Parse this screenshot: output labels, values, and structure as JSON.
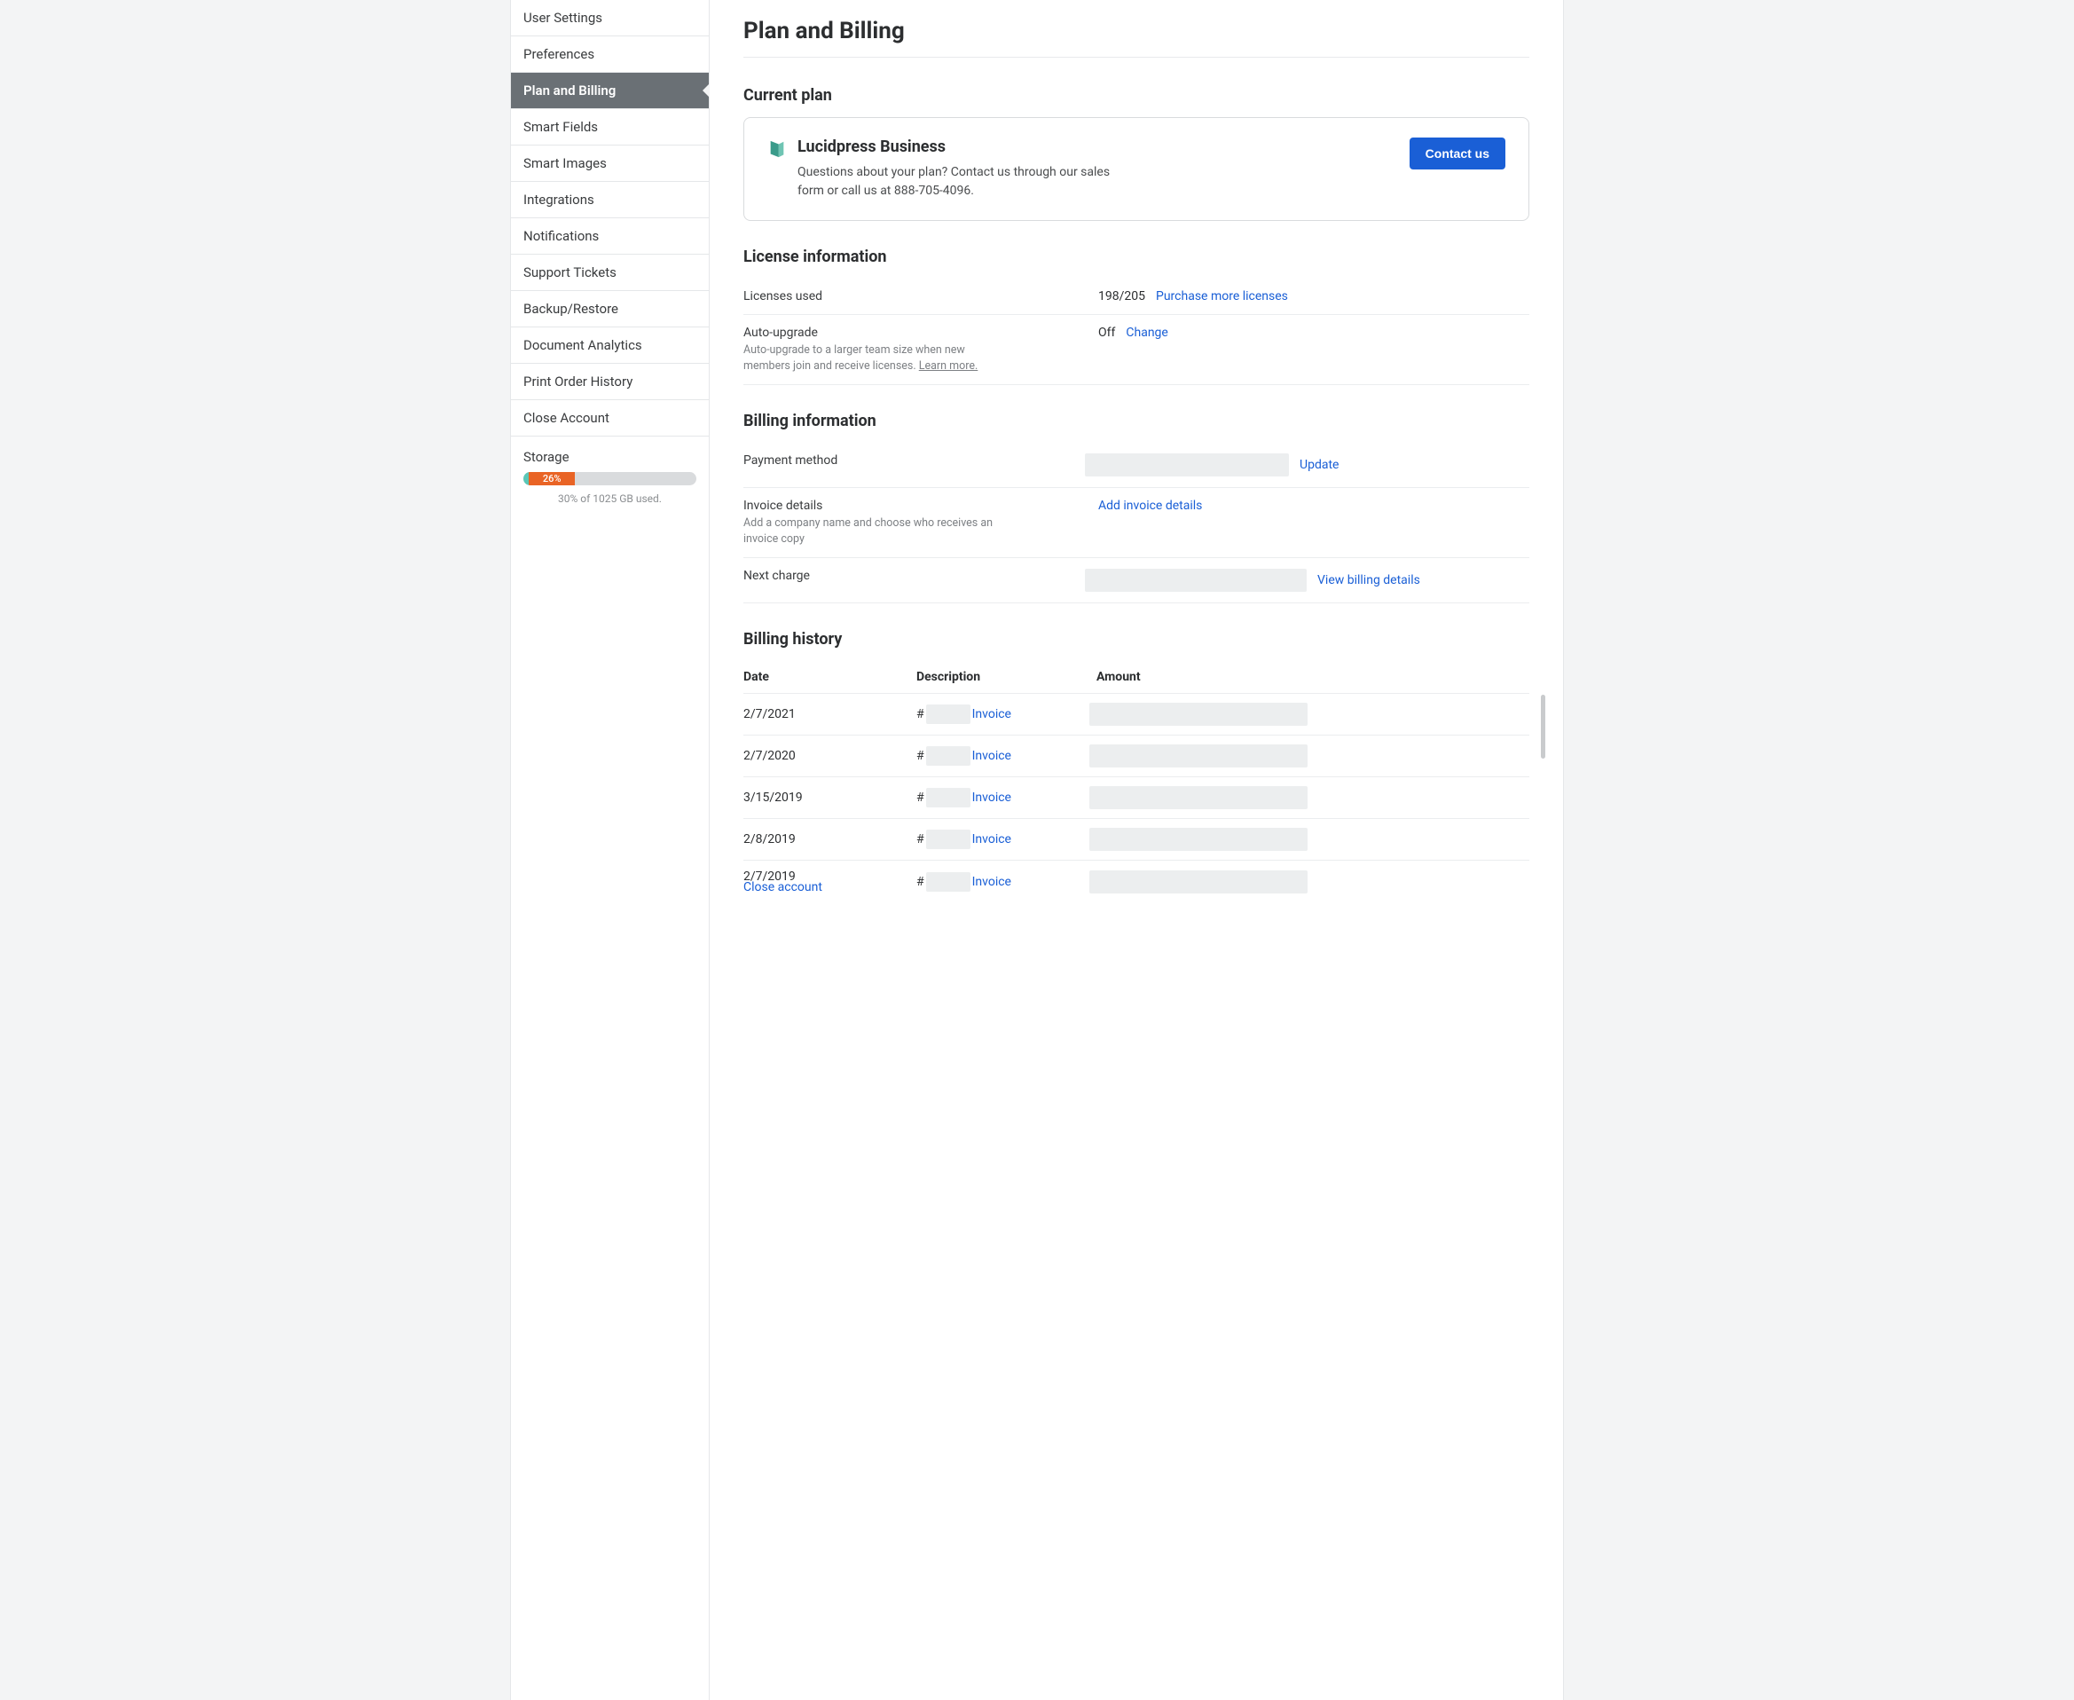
{
  "sidebar": {
    "items": [
      {
        "label": "User Settings",
        "active": false
      },
      {
        "label": "Preferences",
        "active": false
      },
      {
        "label": "Plan and Billing",
        "active": true
      },
      {
        "label": "Smart Fields",
        "active": false
      },
      {
        "label": "Smart Images",
        "active": false
      },
      {
        "label": "Integrations",
        "active": false
      },
      {
        "label": "Notifications",
        "active": false
      },
      {
        "label": "Support Tickets",
        "active": false
      },
      {
        "label": "Backup/Restore",
        "active": false
      },
      {
        "label": "Document Analytics",
        "active": false
      },
      {
        "label": "Print Order History",
        "active": false
      },
      {
        "label": "Close Account",
        "active": false
      }
    ],
    "storage": {
      "title": "Storage",
      "percent_label": "26%",
      "caption": "30% of 1025 GB used."
    }
  },
  "page": {
    "title": "Plan and Billing"
  },
  "current_plan": {
    "section_title": "Current plan",
    "plan_name": "Lucidpress Business",
    "description": "Questions about your plan? Contact us through our sales form or call us at 888-705-4096.",
    "contact_button": "Contact us"
  },
  "license_info": {
    "section_title": "License information",
    "licenses_used_label": "Licenses used",
    "licenses_used_value": "198/205",
    "purchase_link": "Purchase more licenses",
    "auto_upgrade_label": "Auto-upgrade",
    "auto_upgrade_sub": "Auto-upgrade to a larger team size when new members join and receive licenses. ",
    "learn_more": "Learn more.",
    "auto_upgrade_value": "Off",
    "change_link": "Change"
  },
  "billing_info": {
    "section_title": "Billing information",
    "payment_method_label": "Payment method",
    "update_link": "Update",
    "invoice_details_label": "Invoice details",
    "invoice_details_sub": "Add a company name and choose who receives an invoice copy",
    "add_invoice_link": "Add invoice details",
    "next_charge_label": "Next charge",
    "view_billing_link": "View billing details"
  },
  "billing_history": {
    "section_title": "Billing history",
    "columns": {
      "date": "Date",
      "description": "Description",
      "amount": "Amount"
    },
    "invoice_link_label": "Invoice",
    "rows": [
      {
        "date": "2/7/2021",
        "hash": "#"
      },
      {
        "date": "2/7/2020",
        "hash": "#"
      },
      {
        "date": "3/15/2019",
        "hash": "#"
      },
      {
        "date": "2/8/2019",
        "hash": "#"
      },
      {
        "date": "2/7/2019",
        "hash": "#"
      }
    ],
    "close_account": "Close account"
  }
}
